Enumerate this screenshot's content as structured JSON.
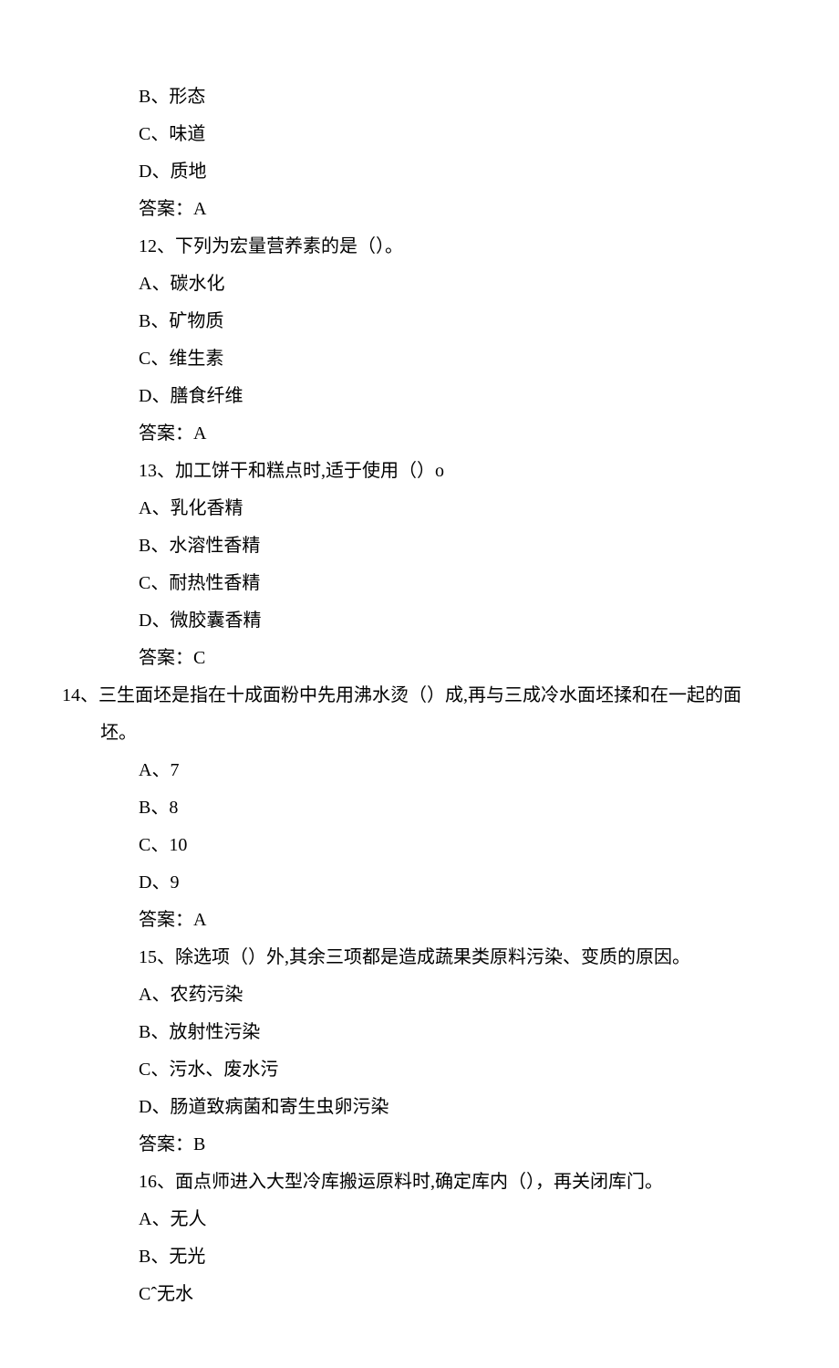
{
  "lines": [
    {
      "cls": "content",
      "text": "B、形态"
    },
    {
      "cls": "content",
      "text": "C、味道"
    },
    {
      "cls": "content",
      "text": "D、质地"
    },
    {
      "cls": "content",
      "text": "答案：A"
    },
    {
      "cls": "content",
      "text": "12、下列为宏量营养素的是（）。"
    },
    {
      "cls": "content",
      "text": "A、碳水化"
    },
    {
      "cls": "content",
      "text": "B、矿物质"
    },
    {
      "cls": "content",
      "text": "C、维生素"
    },
    {
      "cls": "content",
      "text": "D、膳食纤维"
    },
    {
      "cls": "content",
      "text": "答案：A"
    },
    {
      "cls": "content",
      "text": "13、加工饼干和糕点时,适于使用（）o"
    },
    {
      "cls": "content",
      "text": "A、乳化香精"
    },
    {
      "cls": "content",
      "text": "B、水溶性香精"
    },
    {
      "cls": "content",
      "text": "C、耐热性香精"
    },
    {
      "cls": "content",
      "text": "D、微胶囊香精"
    },
    {
      "cls": "content",
      "text": "答案：C"
    },
    {
      "cls": "hang",
      "text": "14、三生面坯是指在十成面粉中先用沸水烫（）成,再与三成冷水面坯揉和在一起的面坯。"
    },
    {
      "cls": "content",
      "text": "A、7"
    },
    {
      "cls": "content",
      "text": "B、8"
    },
    {
      "cls": "content",
      "text": "C、10"
    },
    {
      "cls": "content",
      "text": "D、9"
    },
    {
      "cls": "content",
      "text": "答案：A"
    },
    {
      "cls": "content",
      "text": "15、除选项（）外,其余三项都是造成蔬果类原料污染、变质的原因。"
    },
    {
      "cls": "content",
      "text": "A、农药污染"
    },
    {
      "cls": "content",
      "text": "B、放射性污染"
    },
    {
      "cls": "content",
      "text": "C、污水、废水污"
    },
    {
      "cls": "content",
      "text": "D、肠道致病菌和寄生虫卵污染"
    },
    {
      "cls": "content",
      "text": "答案：B"
    },
    {
      "cls": "content",
      "text": "16、面点师进入大型冷库搬运原料时,确定库内（），再关闭库门。"
    },
    {
      "cls": "content",
      "text": "A、无人"
    },
    {
      "cls": "content",
      "text": "B、无光"
    },
    {
      "cls": "content",
      "text": "Cˆ无水"
    }
  ]
}
